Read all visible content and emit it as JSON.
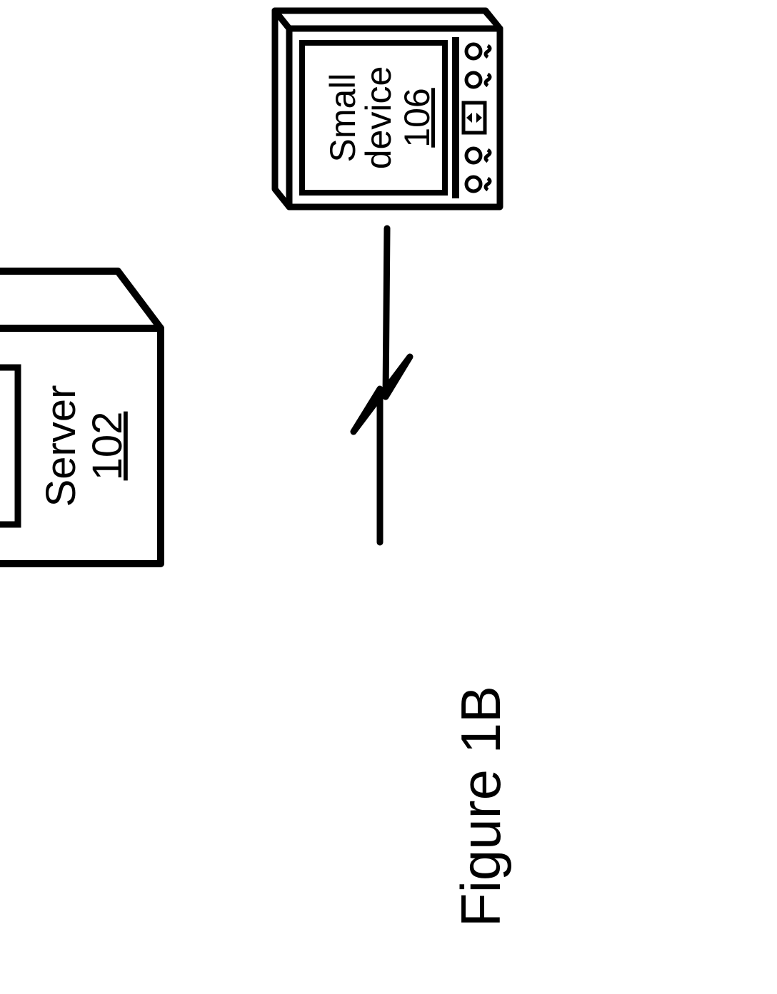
{
  "server": {
    "label": "Server",
    "ref": "102"
  },
  "device": {
    "line1": "Small",
    "line2": "device",
    "ref": "106"
  },
  "figure_caption": "Figure 1B"
}
